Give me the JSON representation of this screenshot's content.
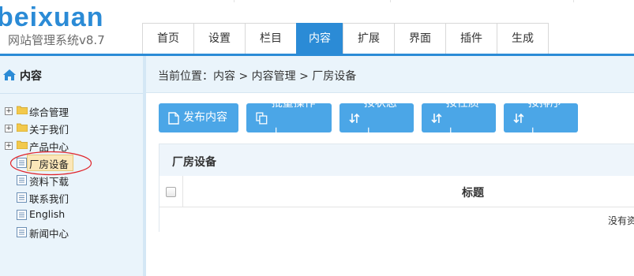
{
  "header": {
    "logo_text": "beixuan",
    "logo_subtitle": "网站管理系统v8.7",
    "nav_tabs": [
      {
        "label": "首页",
        "active": false
      },
      {
        "label": "设置",
        "active": false
      },
      {
        "label": "栏目",
        "active": false
      },
      {
        "label": "内容",
        "active": true
      },
      {
        "label": "扩展",
        "active": false
      },
      {
        "label": "界面",
        "active": false
      },
      {
        "label": "插件",
        "active": false
      },
      {
        "label": "生成",
        "active": false
      }
    ]
  },
  "sidebar": {
    "title": "内容",
    "icon": "home-icon",
    "tree": [
      {
        "label": "综合管理",
        "type": "folder",
        "expandable": true
      },
      {
        "label": "关于我们",
        "type": "folder",
        "expandable": true
      },
      {
        "label": "产品中心",
        "type": "folder",
        "expandable": true
      },
      {
        "label": "厂房设备",
        "type": "page",
        "selected": true
      },
      {
        "label": "资料下载",
        "type": "page"
      },
      {
        "label": "联系我们",
        "type": "page"
      },
      {
        "label": "English",
        "type": "page"
      },
      {
        "label": "新闻中心",
        "type": "page"
      }
    ]
  },
  "breadcrumb": {
    "text": "当前位置：内容 > 内容管理 > 厂房设备"
  },
  "toolbar": {
    "buttons": [
      {
        "label": "发布内容",
        "icon": "document-icon"
      },
      {
        "label": "批量操作↓",
        "icon": "copy-icon"
      },
      {
        "label": "按状态↓",
        "icon": "sort-icon"
      },
      {
        "label": "按性质↓",
        "icon": "sort-icon"
      },
      {
        "label": "按排序↓",
        "icon": "sort-icon"
      }
    ]
  },
  "panel": {
    "title": "厂房设备",
    "column_title": "标题",
    "empty_text": "没有资"
  },
  "colors": {
    "accent": "#2b8bd6",
    "button": "#4ba6e7",
    "sidebar_bg": "#eaf4fb",
    "highlight_circle": "#e0242a"
  }
}
